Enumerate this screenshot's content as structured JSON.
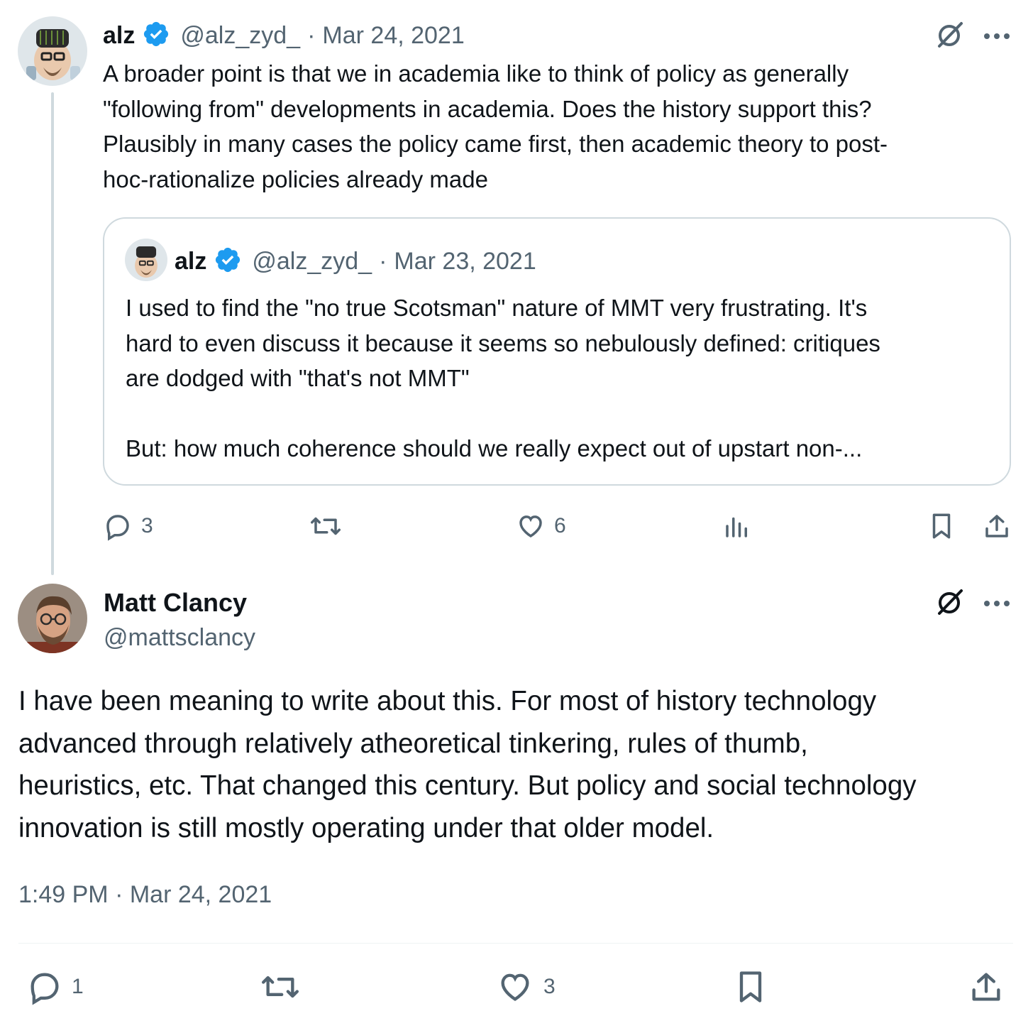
{
  "reply_tweet": {
    "author_name": "alz",
    "handle": "@alz_zyd_",
    "separator": "·",
    "date": "Mar 24, 2021",
    "text": "A broader point is that we in academia like to think of policy as generally\n\"following from\" developments in academia. Does the history support this?\nPlausibly in many cases the policy came first, then academic theory to post-\nhoc-rationalize policies already made",
    "verified": true,
    "icons": [
      "grok-icon",
      "more-icon"
    ],
    "quoted_tweet": {
      "author_name": "alz",
      "handle": "@alz_zyd_",
      "separator": "·",
      "date": "Mar 23, 2021",
      "text": "I used to find the \"no true Scotsman\" nature of MMT very frustrating. It's\nhard to even discuss it because it seems so nebulously defined: critiques\nare dodged with \"that's not MMT\"\n\nBut: how much coherence should we really expect out of upstart non-...",
      "verified": true
    },
    "actions": {
      "replies": "3",
      "retweets": "",
      "likes": "6",
      "views": ""
    }
  },
  "main_tweet": {
    "author_name": "Matt Clancy",
    "handle": "@mattsclancy",
    "text": "I have been meaning to write about this. For most of history technology\nadvanced through relatively atheoretical tinkering, rules of thumb,\nheuristics, etc. That changed this century. But policy and social technology\ninnovation is still mostly operating under that older model.",
    "timestamp": "1:49 PM · Mar 24, 2021",
    "actions": {
      "replies": "1",
      "retweets": "",
      "likes": "3"
    }
  },
  "colors": {
    "text": "#0f1419",
    "muted": "#536471",
    "verified_blue": "#1d9bf0",
    "border": "#cfd9de"
  }
}
